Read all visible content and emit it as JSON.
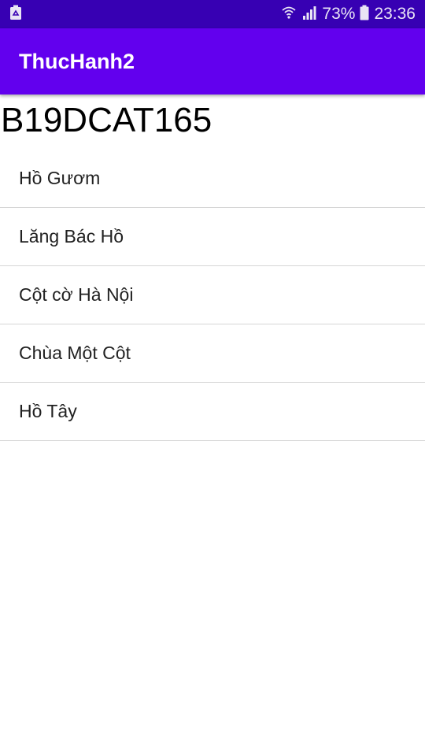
{
  "status_bar": {
    "left_icon": "recycle-notification-icon",
    "wifi_icon": "wifi-icon",
    "signal_icon": "signal-icon",
    "battery_percent": "73%",
    "battery_icon": "battery-icon",
    "time": "23:36"
  },
  "app_bar": {
    "title": "ThucHanh2",
    "color": "#6200ee"
  },
  "header": {
    "student_id": "B19DCAT165"
  },
  "list": {
    "items": [
      {
        "label": "Hồ Gươm"
      },
      {
        "label": "Lăng Bác Hồ"
      },
      {
        "label": "Cột cờ Hà Nội"
      },
      {
        "label": "Chùa Một Cột"
      },
      {
        "label": "Hồ Tây"
      }
    ]
  }
}
